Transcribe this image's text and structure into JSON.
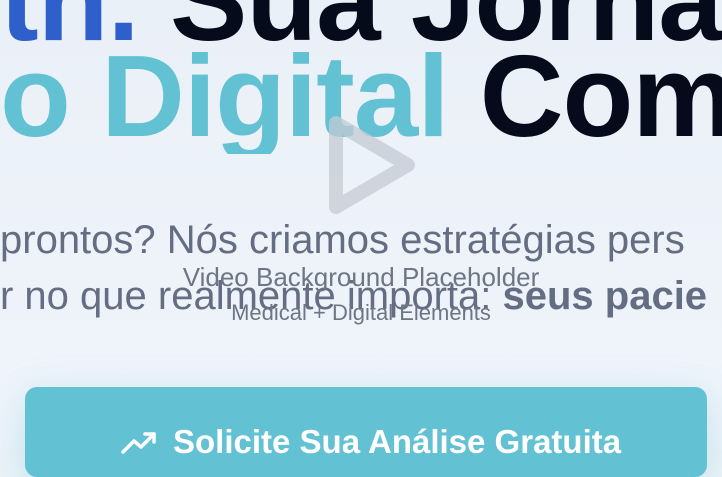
{
  "hero": {
    "line1_part1": "th.",
    "line1_part2": " Sua Jorna",
    "line2_part1": "o Digital",
    "line2_part2": " Com",
    "paragraph_line1": "prontos? Nós criamos estratégias pers",
    "paragraph_line2_prefix": "r no que realmente importa: ",
    "paragraph_line2_bold": "seus pacie"
  },
  "video": {
    "label": "Video Background Placeholder",
    "sub_label": "Medical + Digital Elements",
    "icon": "play-icon"
  },
  "cta": {
    "label": "Solicite Sua Análise Gratuita",
    "icon": "trending-up-icon"
  },
  "colors": {
    "accent_cyan": "#63c1d4",
    "accent_blue": "#2f5fcb",
    "heading_dark": "#050b1a",
    "body_gray": "#646d82"
  }
}
